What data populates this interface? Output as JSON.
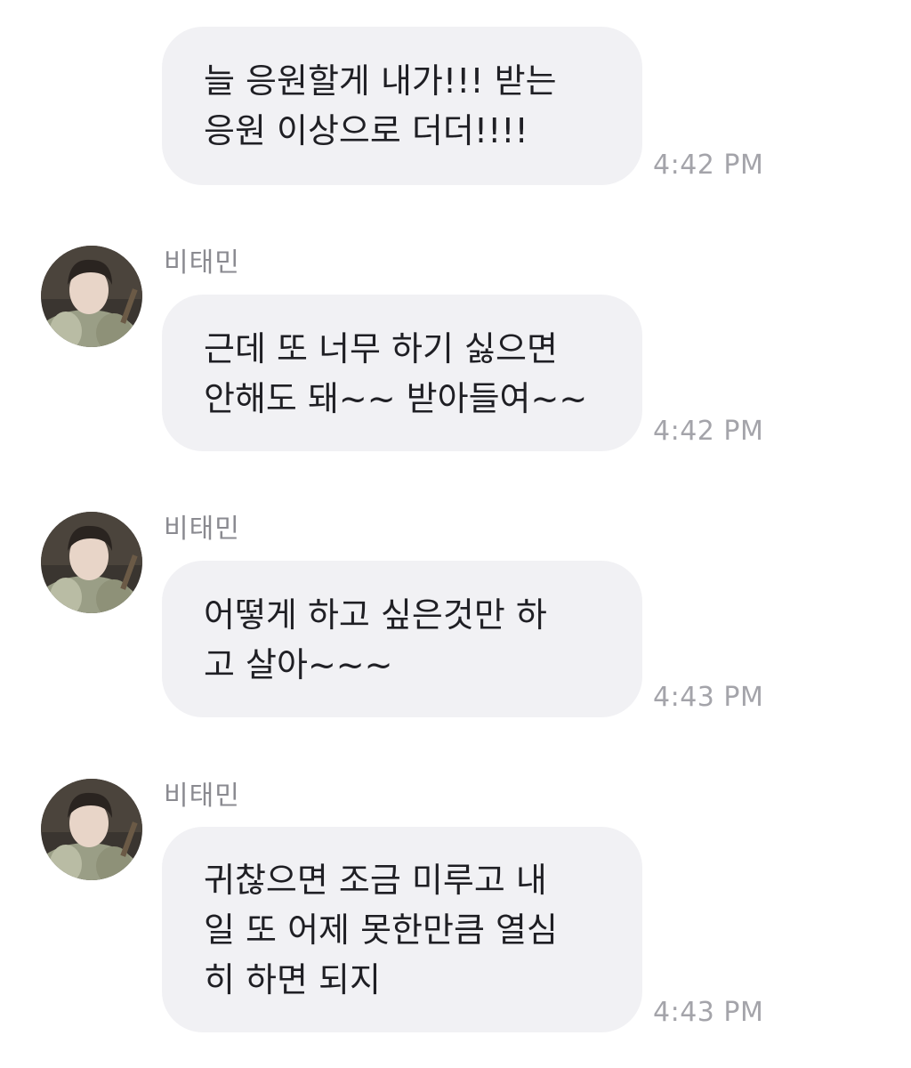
{
  "messages": [
    {
      "sender": "",
      "text": "늘 응원할게 내가!!! 받는\n응원 이상으로 더더!!!!",
      "time": "4:42 PM"
    },
    {
      "sender": "비태민",
      "text": "근데 또 너무 하기 싫으면\n안해도 돼~~ 받아들여~~",
      "time": "4:42 PM",
      "avatar": "profile-photo"
    },
    {
      "sender": "비태민",
      "text": "어떻게 하고 싶은것만 하\n고 살아~~~",
      "time": "4:43 PM",
      "avatar": "profile-photo"
    },
    {
      "sender": "비태민",
      "text": "귀찮으면 조금 미루고 내\n일 또 어제 못한만큼 열심\n히 하면 되지",
      "time": "4:43 PM",
      "avatar": "profile-photo"
    }
  ],
  "colors": {
    "bubble": "#f1f1f4",
    "text": "#1f1f24",
    "sender": "#8a8a90",
    "time": "#a4a4aa"
  }
}
